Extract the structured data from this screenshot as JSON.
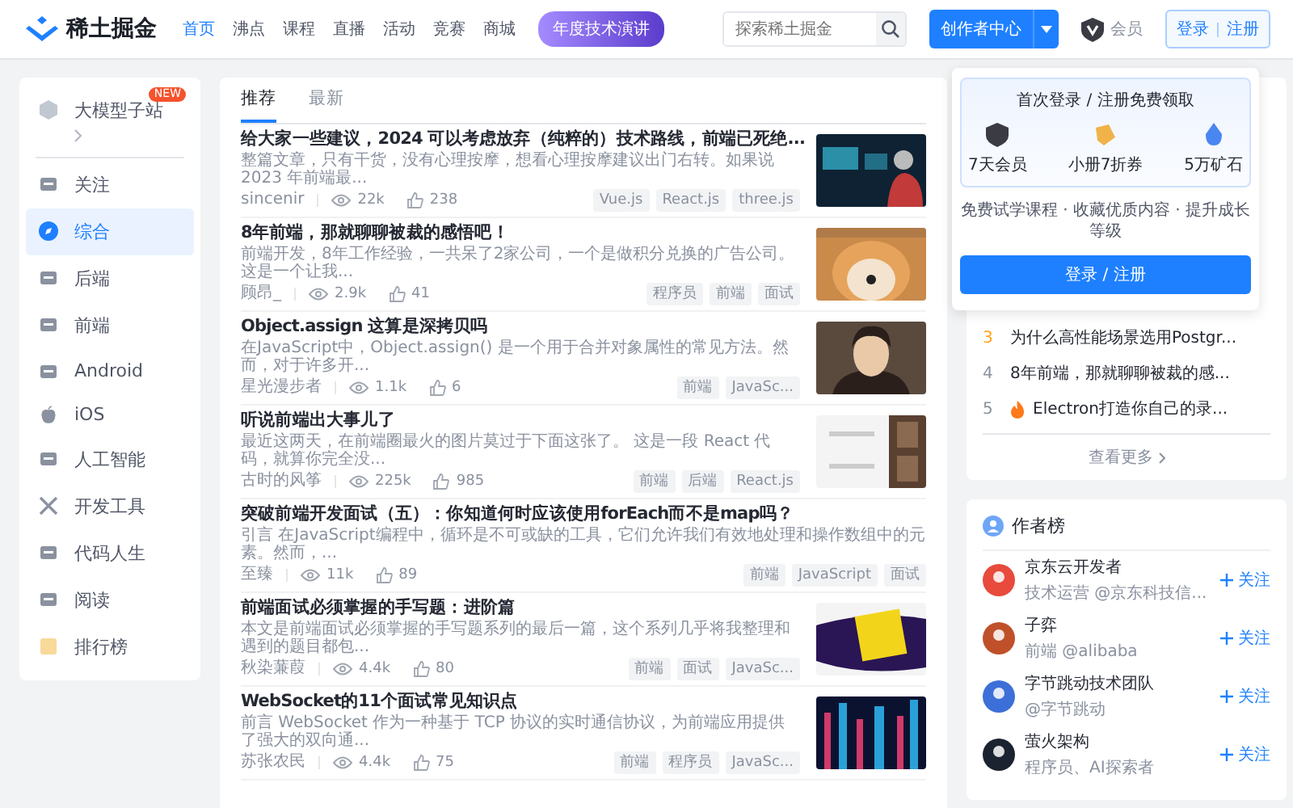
{
  "header": {
    "logo": "稀土掘金",
    "nav": [
      {
        "label": "首页",
        "selected": true
      },
      {
        "label": "沸点",
        "selected": false
      },
      {
        "label": "课程",
        "selected": false
      },
      {
        "label": "直播",
        "selected": false
      },
      {
        "label": "活动",
        "selected": false
      },
      {
        "label": "竞赛",
        "selected": false
      },
      {
        "label": "商城",
        "selected": false
      }
    ],
    "promo": "年度技术演讲",
    "search": {
      "placeholder": "探索稀土掘金"
    },
    "creator": "创作者中心",
    "vip": "会员",
    "login": "登录",
    "register": "注册"
  },
  "sidebar": {
    "items": [
      {
        "label": "大模型子站",
        "badge": "NEW",
        "selected": false
      },
      {
        "label": "关注",
        "selected": false
      },
      {
        "label": "综合",
        "selected": true
      },
      {
        "label": "后端",
        "selected": false
      },
      {
        "label": "前端",
        "selected": false
      },
      {
        "label": "Android",
        "selected": false
      },
      {
        "label": "iOS",
        "selected": false
      },
      {
        "label": "人工智能",
        "selected": false
      },
      {
        "label": "开发工具",
        "selected": false
      },
      {
        "label": "代码人生",
        "selected": false
      },
      {
        "label": "阅读",
        "selected": false
      },
      {
        "label": "排行榜",
        "selected": false
      }
    ]
  },
  "feed": {
    "tabs": [
      {
        "label": "推荐",
        "selected": true
      },
      {
        "label": "最新",
        "selected": false
      }
    ],
    "articles": [
      {
        "title": "给大家一些建议，2024 可以考虑放弃（纯粹的）技术路线，前端已死绝...",
        "summary": "整篇文章，只有干货，没有心理按摩，想看心理按摩建议出门右转。如果说 2023 年前端最...",
        "author": "sincenir",
        "views": "22k",
        "likes": "238",
        "tags": [
          "Vue.js",
          "React.js",
          "three.js"
        ],
        "thumb": {
          "kind": "picture"
        }
      },
      {
        "title": "8年前端，那就聊聊被裁的感悟吧！",
        "summary": "前端开发，8年工作经验，一共呆了2家公司，一个是做积分兑换的广告公司。这是一个让我...",
        "author": "顾昂_",
        "views": "2.9k",
        "likes": "41",
        "tags": [
          "程序员",
          "前端",
          "面试"
        ],
        "thumb": {
          "kind": "picture"
        }
      },
      {
        "title": "Object.assign 这算是深拷贝吗",
        "summary": "在JavaScript中，Object.assign() 是一个用于合并对象属性的常见方法。然而，对于许多开...",
        "author": "星光漫步者",
        "views": "1.1k",
        "likes": "6",
        "tags": [
          "前端",
          "JavaSc..."
        ],
        "thumb": {
          "kind": "picture"
        }
      },
      {
        "title": "听说前端出大事儿了",
        "summary": "最近这两天，在前端圈最火的图片莫过于下面这张了。 这是一段 React 代码，就算你完全没...",
        "author": "古时的风筝",
        "views": "225k",
        "likes": "985",
        "tags": [
          "前端",
          "后端",
          "React.js"
        ],
        "thumb": {
          "kind": "picture"
        }
      },
      {
        "title": "突破前端开发面试（五）：你知道何时应该使用forEach而不是map吗？",
        "summary": "引言 在JavaScript编程中，循环是不可或缺的工具，它们允许我们有效地处理和操作数组中的元素。然而，...",
        "author": "至臻",
        "views": "11k",
        "likes": "89",
        "tags": [
          "前端",
          "JavaScript",
          "面试"
        ]
      },
      {
        "title": "前端面试必须掌握的手写题：进阶篇",
        "summary": "本文是前端面试必须掌握的手写题系列的最后一篇，这个系列几乎将我整理和遇到的题目都包...",
        "author": "秋染蒹葭",
        "views": "4.4k",
        "likes": "80",
        "tags": [
          "前端",
          "面试",
          "JavaSc..."
        ],
        "thumb": {
          "kind": "picture"
        }
      },
      {
        "title": "WebSocket的11个面试常见知识点",
        "summary": "前言 WebSocket 作为一种基于 TCP 协议的实时通信协议，为前端应用提供了强大的双向通...",
        "author": "苏张农民",
        "views": "4.4k",
        "likes": "75",
        "tags": [
          "前端",
          "程序员",
          "JavaSc..."
        ],
        "thumb": {
          "kind": "picture"
        }
      }
    ]
  },
  "login_card": {
    "title": "首次登录 / 注册免费领取",
    "perks": [
      "7天会员",
      "小册7折券",
      "5万矿石"
    ],
    "note": "免费试学课程 · 收藏优质内容 · 提升成长等级",
    "button": "登录 / 注册"
  },
  "hot": {
    "items": [
      {
        "rank": "3",
        "title": "为什么高性能场景选用Postgr...",
        "color": "#ffa116",
        "fire": false
      },
      {
        "rank": "4",
        "title": "8年前端，那就聊聊被裁的感...",
        "color": "#8a919f",
        "fire": false
      },
      {
        "rank": "5",
        "title": "Electron打造你自己的录...",
        "color": "#8a919f",
        "fire": true
      }
    ],
    "more": "查看更多"
  },
  "authors": {
    "title": "作者榜",
    "items": [
      {
        "name": "京东云开发者",
        "desc": "技术运营 @京东科技信...",
        "follow": "关注"
      },
      {
        "name": "子弈",
        "desc": "前端 @alibaba",
        "follow": "关注"
      },
      {
        "name": "字节跳动技术团队",
        "desc": "@字节跳动",
        "follow": "关注"
      },
      {
        "name": "萤火架构",
        "desc": "程序员、AI探索者",
        "follow": "关注"
      }
    ]
  }
}
